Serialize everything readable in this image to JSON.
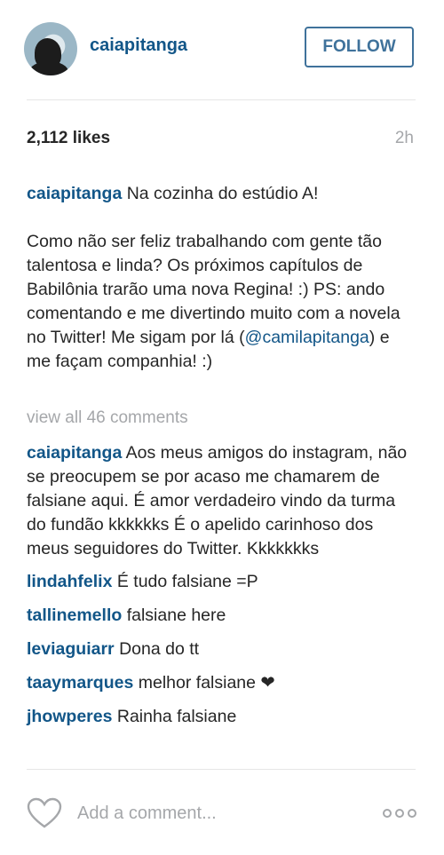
{
  "header": {
    "username": "caiapitanga",
    "follow_label": "FOLLOW"
  },
  "stats": {
    "likes": "2,112 likes",
    "time": "2h"
  },
  "caption": {
    "username": "caiapitanga",
    "text_1": " Na cozinha do estúdio A!\n\nComo não ser feliz trabalhando com gente tão talentosa e linda? Os próximos capítulos de Babilônia trarão uma nova Regina! :) PS: ando comentando e me divertindo muito com a novela no Twitter! Me sigam por lá (",
    "mention": "@camilapitanga",
    "text_2": ") e me façam companhia! :)"
  },
  "view_all": "view all 46 comments",
  "comments": [
    {
      "user": "caiapitanga",
      "text": "Aos meus amigos do instagram, não se preocupem se por acaso me chamarem de falsiane aqui. É amor verdadeiro vindo da turma do fundão kkkkkks É o apelido carinhoso dos meus seguidores do Twitter. Kkkkkkks"
    },
    {
      "user": "lindahfelix",
      "text": "É tudo falsiane =P"
    },
    {
      "user": "tallinemello",
      "text": "falsiane here"
    },
    {
      "user": "leviaguiarr",
      "text": "Dona do tt"
    },
    {
      "user": "taaymarques",
      "text": "melhor falsiane ❤"
    },
    {
      "user": "jhowperes",
      "text": "Rainha falsiane"
    }
  ],
  "footer": {
    "comment_placeholder": "Add a comment...",
    "heart_icon": "heart-icon",
    "more_icon": "more-options-icon"
  }
}
